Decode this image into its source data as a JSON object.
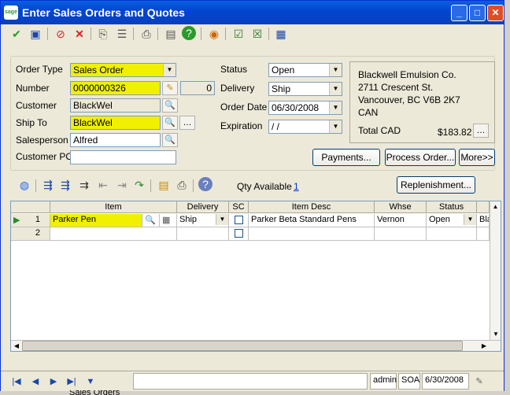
{
  "window": {
    "title": "Enter Sales Orders and Quotes",
    "logo": "sage"
  },
  "title_buttons": [
    "_",
    "□",
    "✕"
  ],
  "toolbar_icons": [
    "accept-icon",
    "save-icon",
    "delete-icon",
    "cancel-icon",
    "copy-icon",
    "notes-icon",
    "print-icon",
    "print-preview-icon",
    "help-icon",
    "color-wheel-icon",
    "check-icon",
    "undo-check-icon",
    "reports-icon"
  ],
  "form": {
    "order_type_label": "Order Type",
    "order_type": "Sales Order",
    "number_label": "Number",
    "number": "0000000326",
    "number_suffix": "0",
    "customer_label": "Customer",
    "customer": "BlackWel",
    "ship_to_label": "Ship To",
    "ship_to": "BlackWel",
    "salesperson_label": "Salesperson",
    "salesperson": "Alfred",
    "customer_po_label": "Customer PO",
    "customer_po": "",
    "status_label": "Status",
    "status": "Open",
    "delivery_label": "Delivery",
    "delivery": "Ship",
    "order_date_label": "Order Date",
    "order_date": "06/30/2008",
    "expiration_label": "Expiration",
    "expiration": " /  /"
  },
  "address": {
    "line1": "Blackwell Emulsion Co.",
    "line2": "2711 Crescent St.",
    "line3": "Vancouver, BC  V6B 2K7",
    "line4": "CAN",
    "total_label": "Total CAD",
    "total": "$183.82"
  },
  "buttons": {
    "payments": "Payments...",
    "process": "Process Order...",
    "more": "More>>",
    "replenishment": "Replenishment..."
  },
  "qty_available_label": "Qty Available",
  "qty_available": "1",
  "grid": {
    "headers": [
      "Item",
      "Delivery",
      "SC",
      "Item Desc",
      "Whse",
      "Status"
    ],
    "rows": [
      {
        "num": "1",
        "item": "Parker Pen",
        "delivery": "Ship",
        "desc": "Parker Beta Standard Pens",
        "whse": "Vernon",
        "status": "Open",
        "extra": "Bla"
      },
      {
        "num": "2",
        "item": "",
        "delivery": "",
        "desc": "",
        "whse": "",
        "status": "",
        "extra": ""
      }
    ]
  },
  "statusbar": {
    "user": "admin",
    "company": "SOA",
    "date": "6/30/2008"
  },
  "background": {
    "partial_text": "Sales Orders"
  },
  "colors": {
    "highlight": "#f0f000",
    "titlebar": "#0246cf",
    "link": "#0033cc"
  }
}
